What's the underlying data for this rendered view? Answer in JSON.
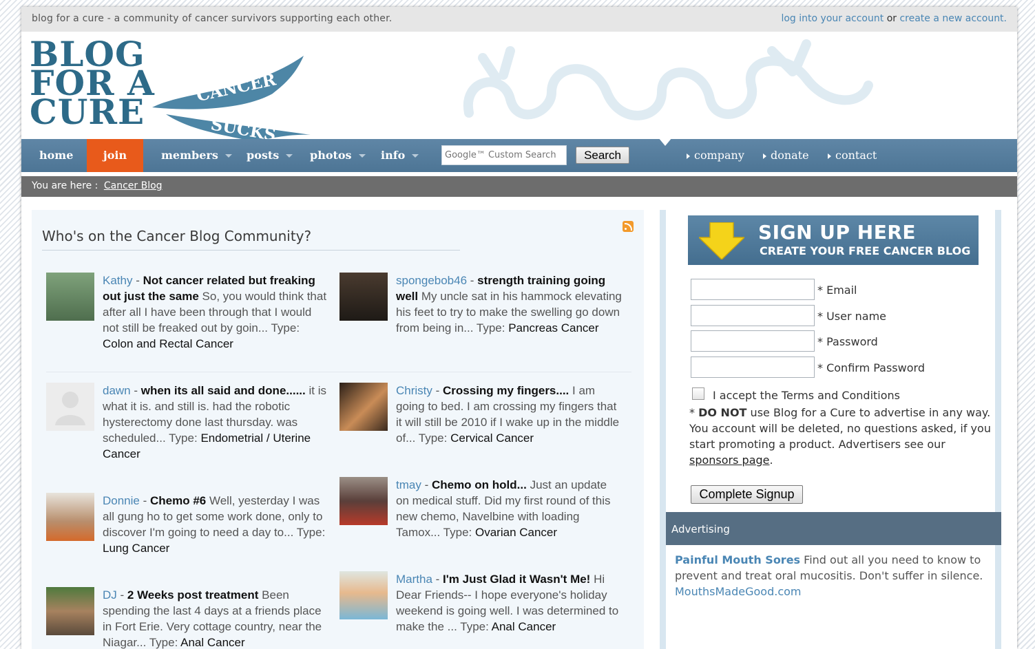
{
  "topbar": {
    "tagline": "blog for a cure - a community of cancer survivors supporting each other.",
    "login_link": "log into your account",
    "or_text": "or",
    "create_link": "create a new account."
  },
  "logo": {
    "line1": "BLOG",
    "line2": "FOR A",
    "line3": "CURE",
    "ribbon_top": "CANCER",
    "ribbon_bottom": "SUCKS"
  },
  "nav": {
    "home": "home",
    "join": "join",
    "members": "members",
    "posts": "posts",
    "photos": "photos",
    "info": "info",
    "search_placeholder": "Google™ Custom Search",
    "search_button": "Search",
    "company": "company",
    "donate": "donate",
    "contact": "contact"
  },
  "breadcrumb": {
    "prefix": "You are here :",
    "current": "Cancer Blog"
  },
  "main": {
    "title": "Who's on the Cancer Blog Community?",
    "posts": [
      {
        "name": "Kathy",
        "subject": "Not cancer related but freaking out just the same",
        "excerpt": "So, you would think that after all I have been through that I would not still be freaked out by goin...",
        "type_label": "Type:",
        "type": "Colon and Rectal Cancer"
      },
      {
        "name": "spongebob46",
        "subject": "strength training going well",
        "excerpt": "My uncle sat in his hammock elevating his feet to try to make the swelling go down from being in...",
        "type_label": "Type:",
        "type": "Pancreas Cancer"
      },
      {
        "name": "dawn",
        "subject": "when its all said and done......",
        "excerpt": "it is what it is. and still is. had the robotic hysterectomy done last thursday. was scheduled...",
        "type_label": "Type:",
        "type": "Endometrial / Uterine Cancer"
      },
      {
        "name": "Christy",
        "subject": "Crossing my fingers....",
        "excerpt": "I am going to bed. I am crossing my fingers that it will still be 2010 if I wake up in the middle of...",
        "type_label": "Type:",
        "type": "Cervical Cancer"
      },
      {
        "name": "Donnie",
        "subject": "Chemo #6",
        "excerpt": "Well, yesterday I was all gung ho to get some work done, only to discover I'm going to need a day to...",
        "type_label": "Type:",
        "type": "Lung Cancer"
      },
      {
        "name": "tmay",
        "subject": "Chemo on hold...",
        "excerpt": "Just an update on medical stuff. Did my first round of this new chemo, Navelbine with loading Tamox...",
        "type_label": "Type:",
        "type": "Ovarian Cancer"
      },
      {
        "name": "DJ",
        "subject": "2 Weeks post treatment",
        "excerpt": "Been spending the last 4 days at a friends place in Fort Erie. Very cottage country, near the Niagar...",
        "type_label": "Type:",
        "type": "Anal Cancer"
      },
      {
        "name": "Martha",
        "subject": "I'm Just Glad it Wasn't Me!",
        "excerpt": "Hi Dear Friends-- I hope everyone's holiday weekend is going well. I was determined to make the ...",
        "type_label": "Type:",
        "type": "Anal Cancer"
      }
    ]
  },
  "signup": {
    "banner_title": "SIGN UP HERE",
    "banner_subtitle": "CREATE YOUR FREE CANCER BLOG",
    "email_label": "* Email",
    "username_label": "* User name",
    "password_label": "* Password",
    "confirm_label": "* Confirm Password",
    "terms_prefix": "I accept the",
    "terms_link": "Terms and Conditions",
    "notice_star": "*",
    "notice_bold": "DO NOT",
    "notice_text": "use Blog for a Cure to advertise in any way. You account will be deleted, no questions asked, if you start promoting a product. Advertisers see our",
    "sponsors_link": "sponsors page",
    "notice_end": ".",
    "button": "Complete Signup"
  },
  "advertising": {
    "heading": "Advertising",
    "ad_title": "Painful Mouth Sores",
    "ad_text": "Find out all you need to know to prevent and treat oral mucositis. Don't suffer in silence.",
    "ad_url": "MouthsMadeGood.com"
  },
  "colors": {
    "nav_blue": "#5a82a2",
    "join_orange": "#e85a1b",
    "link_blue": "#4a86b4",
    "logo_teal": "#2d6a88"
  }
}
